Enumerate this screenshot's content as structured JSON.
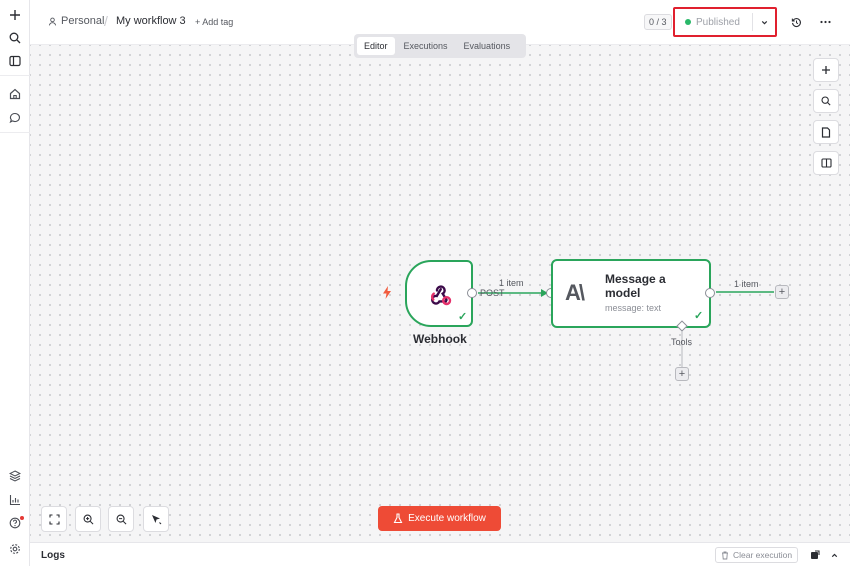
{
  "header": {
    "project": "Personal",
    "separator": "/",
    "workflow_name": "My workflow 3",
    "add_tag": "+ Add tag",
    "counter": "0 / 3",
    "publish_label": "Published"
  },
  "tabs": [
    {
      "label": "Editor",
      "active": true
    },
    {
      "label": "Executions",
      "active": false
    },
    {
      "label": "Evaluations",
      "active": false
    }
  ],
  "nodes": {
    "webhook": {
      "label": "Webhook",
      "output_label": "POST"
    },
    "message": {
      "title": "Message a model",
      "subtitle": "message: text",
      "tools_label": "Tools",
      "logo": "A\\"
    }
  },
  "edges": {
    "webhook_to_message": "1 item",
    "message_out": "1 item"
  },
  "execute_button": "Execute workflow",
  "logs": {
    "title": "Logs",
    "clear_label": "Clear execution"
  },
  "colors": {
    "accent": "#ee4b36",
    "success": "#2aa55b",
    "highlight_border": "#e0202e"
  },
  "icons": {
    "rail_top": [
      "plus-icon",
      "search-icon",
      "sidebar-icon",
      "home-icon",
      "chat-icon"
    ],
    "rail_bottom": [
      "templates-icon",
      "insights-icon",
      "help-icon",
      "settings-icon"
    ]
  }
}
